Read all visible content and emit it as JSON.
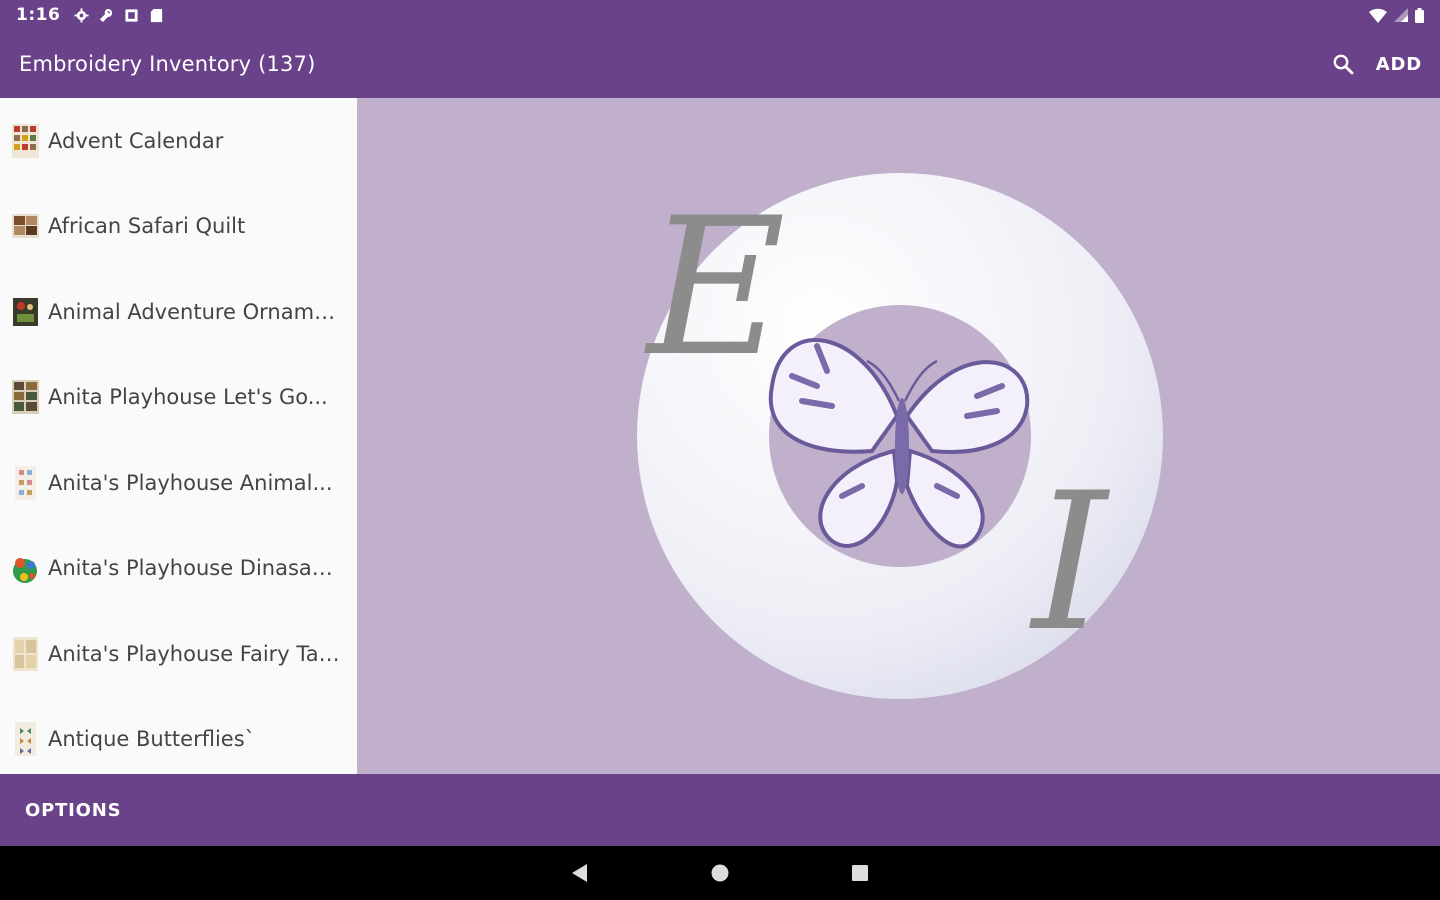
{
  "status_bar": {
    "time": "1:16",
    "left_icons": [
      "gear-icon",
      "wrench-icon",
      "notification-icon",
      "sd-card-icon"
    ],
    "right_icons": [
      "wifi-icon",
      "signal-icon",
      "battery-icon"
    ]
  },
  "app_bar": {
    "title": "Embroidery Inventory (137)",
    "search_icon": "search-icon",
    "add_label": "ADD"
  },
  "list": {
    "items": [
      {
        "label": "Advent Calendar"
      },
      {
        "label": "African Safari Quilt"
      },
      {
        "label": "Animal Adventure Orname..."
      },
      {
        "label": "Anita Playhouse Let's Go..."
      },
      {
        "label": "Anita's Playhouse Animal..."
      },
      {
        "label": "Anita's Playhouse Dinasau..."
      },
      {
        "label": "Anita's Playhouse Fairy Tai..."
      },
      {
        "label": "Antique Butterflies`"
      }
    ]
  },
  "detail": {
    "logo_letters": [
      "E",
      "I"
    ]
  },
  "bottom_bar": {
    "options_label": "OPTIONS"
  },
  "nav_bar": {
    "icons": [
      "back-icon",
      "home-icon",
      "recents-icon"
    ]
  },
  "colors": {
    "primary": "#6a428a",
    "background": "#c0b0cc",
    "list_background": "#fafafa"
  }
}
